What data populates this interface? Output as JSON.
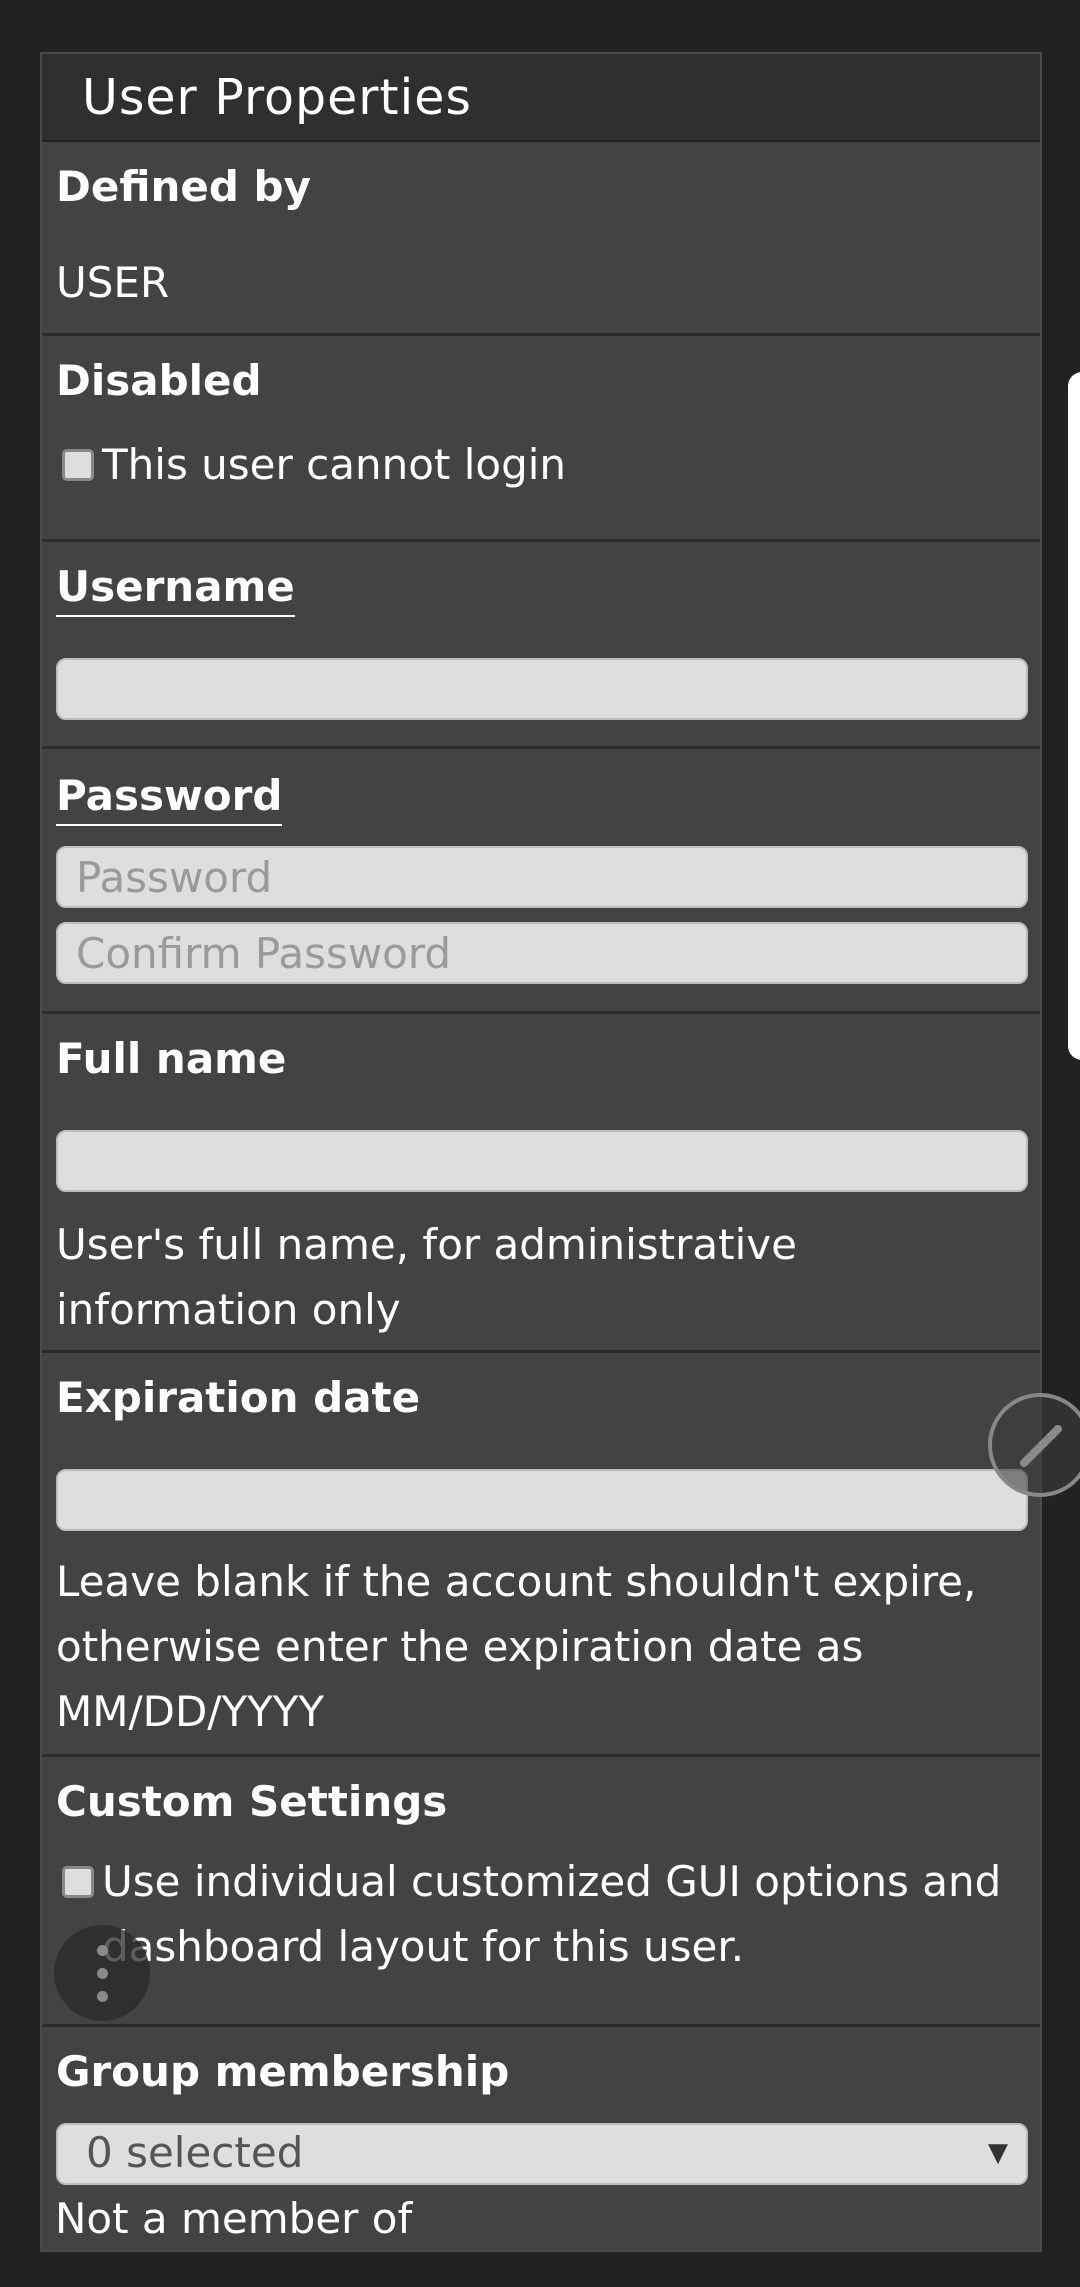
{
  "panel": {
    "title": "User Properties"
  },
  "fields": {
    "defined_by": {
      "label": "Defined by",
      "value": "USER"
    },
    "disabled": {
      "label": "Disabled",
      "checkbox_label": "This user cannot login",
      "checked": false
    },
    "username": {
      "label": "Username",
      "value": ""
    },
    "password": {
      "label": "Password",
      "placeholder": "Password",
      "confirm_placeholder": "Confirm Password"
    },
    "full_name": {
      "label": "Full name",
      "value": "",
      "help": "User's full name, for administrative information only"
    },
    "expiration_date": {
      "label": "Expiration date",
      "value": "",
      "help": "Leave blank if the account shouldn't expire, otherwise enter the expiration date as MM/DD/YYYY"
    },
    "custom_settings": {
      "label": "Custom Settings",
      "checkbox_label": "Use individual customized GUI options and dashboard layout for this user.",
      "checked": false
    },
    "group_membership": {
      "label": "Group membership",
      "selected": "0 selected",
      "note_partial": "Not a member of"
    }
  },
  "icons": {
    "edit": "pencil-icon",
    "menu": "more-vertical-icon",
    "dropdown": "caret-down-icon"
  },
  "colors": {
    "page_bg": "#222222",
    "panel_bg": "#434343",
    "header_bg": "#2f2f2f",
    "input_bg": "#dedede",
    "placeholder": "#9a9a9a"
  }
}
